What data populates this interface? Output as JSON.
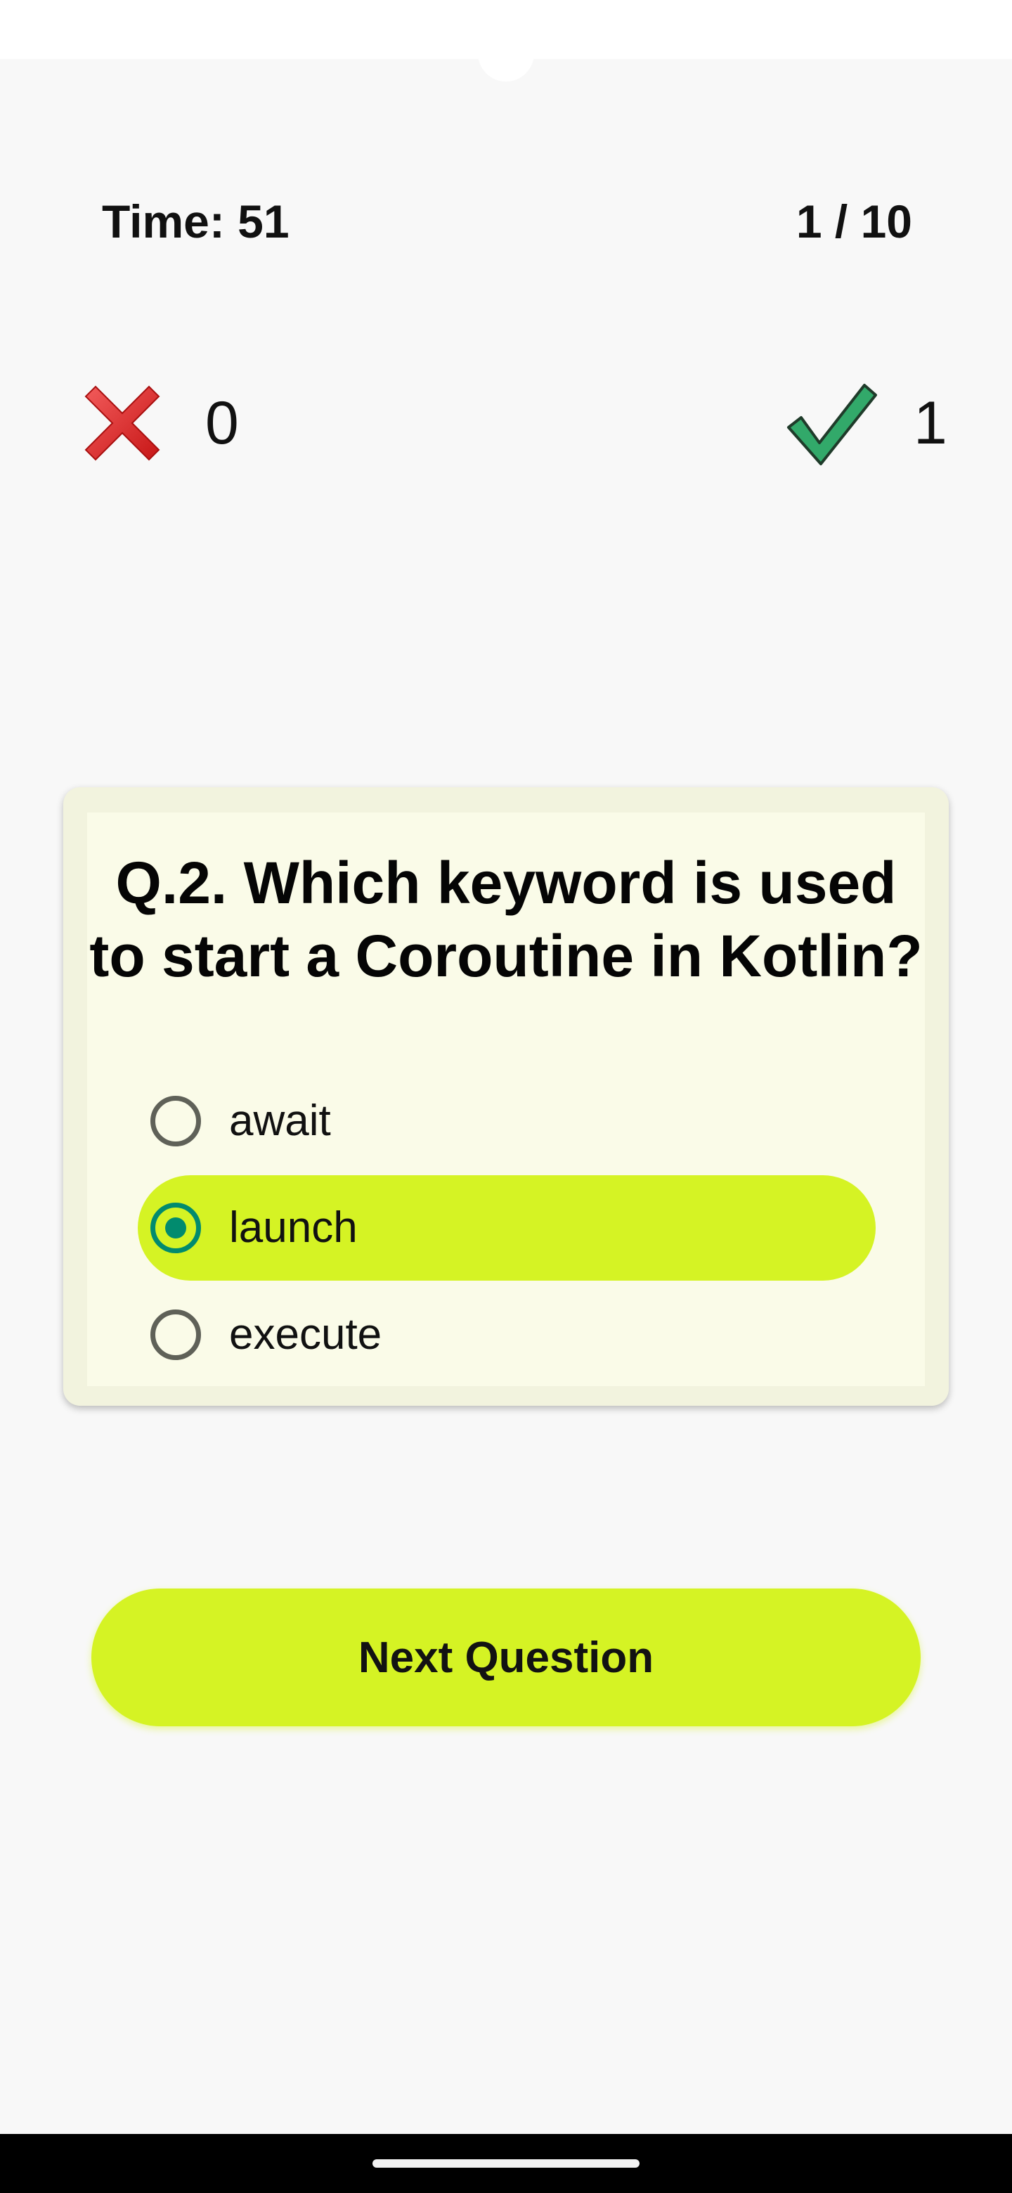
{
  "header": {
    "timer_text": "Time: 51",
    "progress_text": "1 / 10"
  },
  "score": {
    "wrong_icon": "red-x-icon",
    "wrong_count": "0",
    "correct_icon": "green-check-icon",
    "correct_count": "1"
  },
  "question": {
    "line1": "Q.2. Which keyword is used",
    "line2": "to start a Coroutine in Kotlin?",
    "options": [
      {
        "label": "await",
        "selected": false
      },
      {
        "label": "launch",
        "selected": true
      },
      {
        "label": "execute",
        "selected": false
      }
    ]
  },
  "actions": {
    "next_label": "Next Question"
  },
  "colors": {
    "accent": "#d5f324",
    "radio_selected": "#018b6e",
    "card_background": "#fafbe8",
    "page_background": "#f8f8f8"
  }
}
